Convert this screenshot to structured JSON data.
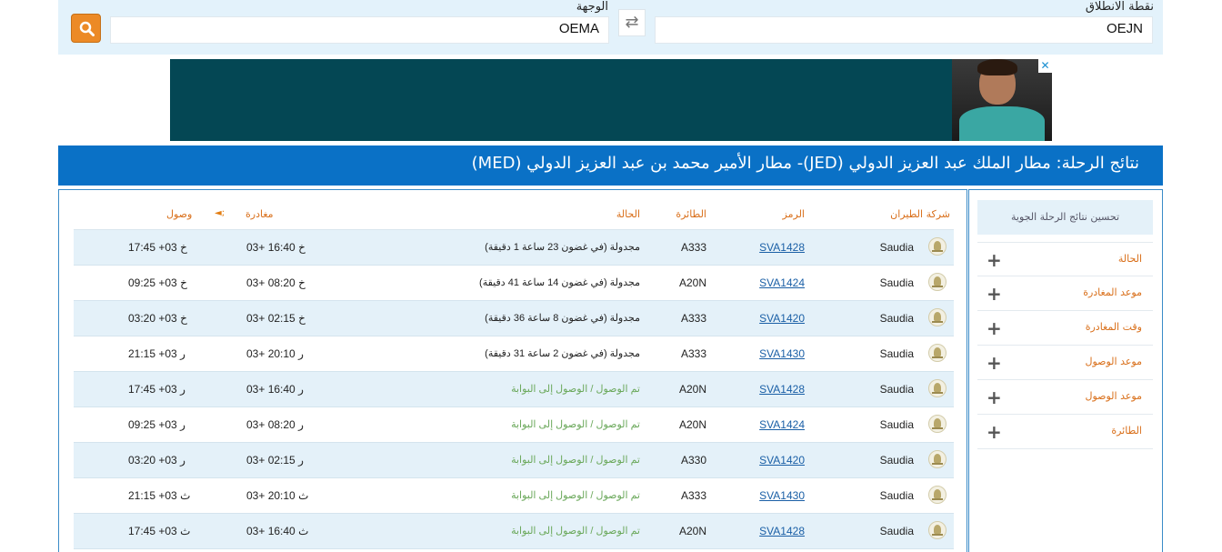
{
  "search": {
    "origin_label": "نقطة الانطلاق",
    "origin_value": "OEJN",
    "destination_label": "الوجهة",
    "destination_value": "OEMA",
    "swap_glyph": "⇄",
    "search_icon": "search-icon"
  },
  "ad": {
    "close_glyph": "✕"
  },
  "results": {
    "title": "نتائج الرحلة:  مطار الملك عبد العزيز الدولي (JED)- مطار الأمير محمد بن عبد العزيز الدولي (MED)"
  },
  "table": {
    "headers": {
      "airline": "شركة الطيران",
      "code": "الرمز",
      "aircraft": "الطائرة",
      "status": "الحالة",
      "departure": "مغادرة",
      "sort_glyph": "◄;",
      "arrival": "وصول"
    },
    "rows": [
      {
        "airline": "Saudia",
        "code": "SVA1428",
        "aircraft": "A333",
        "status": "مجدولة (في غضون 23 ساعة 1 دقيقة)",
        "status_type": "scheduled",
        "departure": "03+ 16:40 خ",
        "arrival": "17:45 +03 خ"
      },
      {
        "airline": "Saudia",
        "code": "SVA1424",
        "aircraft": "A20N",
        "status": "مجدولة (في غضون 14 ساعة 41 دقيقة)",
        "status_type": "scheduled",
        "departure": "03+ 08:20 خ",
        "arrival": "09:25 +03 خ"
      },
      {
        "airline": "Saudia",
        "code": "SVA1420",
        "aircraft": "A333",
        "status": "مجدولة (في غضون 8 ساعة 36 دقيقة)",
        "status_type": "scheduled",
        "departure": "03+ 02:15 خ",
        "arrival": "03:20 +03 خ"
      },
      {
        "airline": "Saudia",
        "code": "SVA1430",
        "aircraft": "A333",
        "status": "مجدولة (في غضون 2 ساعة 31 دقيقة)",
        "status_type": "scheduled",
        "departure": "03+ 20:10 ر",
        "arrival": "21:15 +03 ر"
      },
      {
        "airline": "Saudia",
        "code": "SVA1428",
        "aircraft": "A20N",
        "status": "تم الوصول / الوصول إلى البوابة",
        "status_type": "arrived",
        "departure": "03+ 16:40 ر",
        "arrival": "17:45 +03 ر"
      },
      {
        "airline": "Saudia",
        "code": "SVA1424",
        "aircraft": "A20N",
        "status": "تم الوصول / الوصول إلى البوابة",
        "status_type": "arrived",
        "departure": "03+ 08:20 ر",
        "arrival": "09:25 +03 ر"
      },
      {
        "airline": "Saudia",
        "code": "SVA1420",
        "aircraft": "A330",
        "status": "تم الوصول / الوصول إلى البوابة",
        "status_type": "arrived",
        "departure": "03+ 02:15 ر",
        "arrival": "03:20 +03 ر"
      },
      {
        "airline": "Saudia",
        "code": "SVA1430",
        "aircraft": "A333",
        "status": "تم الوصول / الوصول إلى البوابة",
        "status_type": "arrived",
        "departure": "03+ 20:10 ث",
        "arrival": "21:15 +03 ث"
      },
      {
        "airline": "Saudia",
        "code": "SVA1428",
        "aircraft": "A20N",
        "status": "تم الوصول / الوصول إلى البوابة",
        "status_type": "arrived",
        "departure": "03+ 16:40 ث",
        "arrival": "17:45 +03 ث"
      }
    ]
  },
  "sidebar": {
    "refine_label": "تحسين نتائج الرحلة الجوية",
    "plus_glyph": "+",
    "filters": [
      {
        "label": "الحالة"
      },
      {
        "label": "موعد المغادرة"
      },
      {
        "label": "وقت المغادرة"
      },
      {
        "label": "موعد الوصول"
      },
      {
        "label": "موعد الوصول"
      },
      {
        "label": "الطائرة"
      }
    ]
  },
  "colors": {
    "accent_orange": "#ec8a26",
    "title_blue": "#0a71c6",
    "row_alt": "#e4f1f9",
    "arrived_green": "#6aa85a",
    "link_blue": "#1a5fa6"
  }
}
